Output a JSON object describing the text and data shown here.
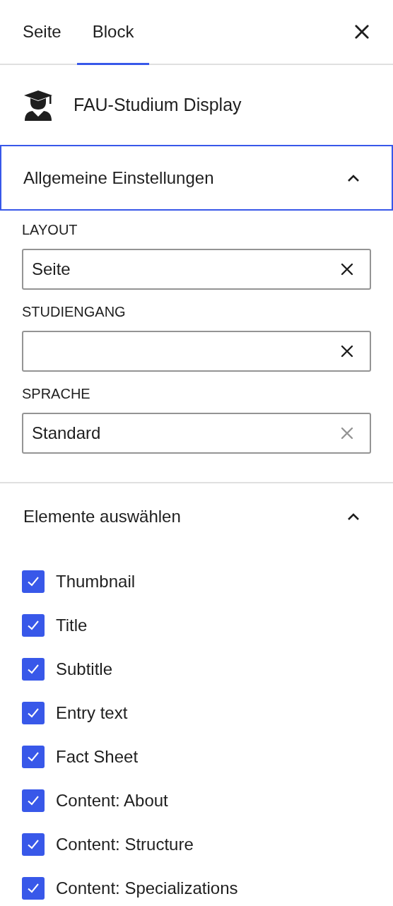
{
  "tabs": [
    {
      "label": "Seite",
      "selected": false
    },
    {
      "label": "Block",
      "selected": true
    }
  ],
  "block": {
    "title": "FAU-Studium Display"
  },
  "sections": [
    {
      "title": "Allgemeine Einstellungen",
      "expanded": true,
      "focused": true,
      "fields": [
        {
          "label": "LAYOUT",
          "value": "Seite",
          "clear_enabled": true
        },
        {
          "label": "STUDIENGANG",
          "clear_enabled": true
        },
        {
          "label": "SPRACHE",
          "value": "Standard",
          "clear_enabled": false
        }
      ]
    },
    {
      "title": "Elemente auswählen",
      "expanded": true,
      "focused": false,
      "checkboxes": [
        {
          "label": "Thumbnail",
          "checked": true
        },
        {
          "label": "Title",
          "checked": true
        },
        {
          "label": "Subtitle",
          "checked": true
        },
        {
          "label": "Entry text",
          "checked": true
        },
        {
          "label": "Fact Sheet",
          "checked": true
        },
        {
          "label": "Content: About",
          "checked": true
        },
        {
          "label": "Content: Structure",
          "checked": true
        },
        {
          "label": "Content: Specializations",
          "checked": true
        }
      ]
    }
  ]
}
